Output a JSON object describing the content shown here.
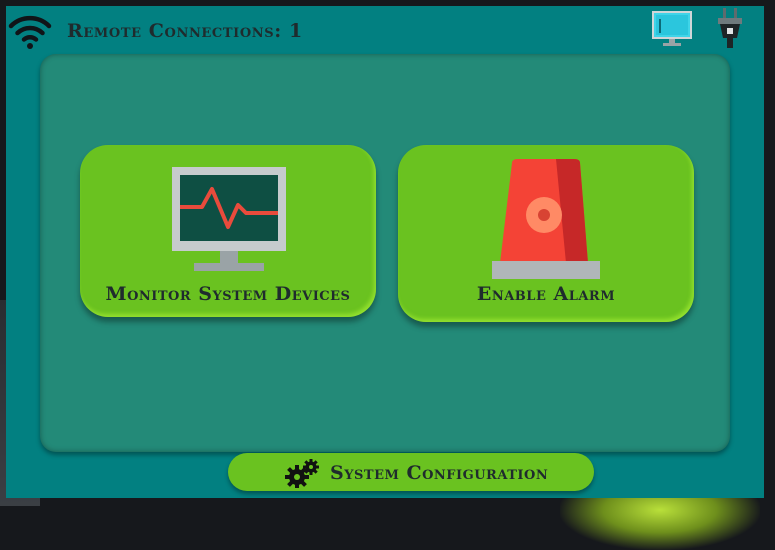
{
  "header": {
    "title": "Remote Connections: 1",
    "icons": [
      "wifi-icon",
      "remote-monitor-icon",
      "power-plug-icon"
    ]
  },
  "tiles": [
    {
      "label": "Monitor System Devices",
      "icon": "monitor-pulse-icon"
    },
    {
      "label": "Enable Alarm",
      "icon": "alarm-beacon-icon"
    }
  ],
  "footer": {
    "config_label": "System Configuration",
    "icon": "gears-icon"
  },
  "colors": {
    "panel": "#028081",
    "main_area": "#238a78",
    "tile": "#6ac220",
    "text": "#1f2b2d",
    "alarm_red": "#f44336",
    "monitor_screen": "#0e4f43"
  }
}
